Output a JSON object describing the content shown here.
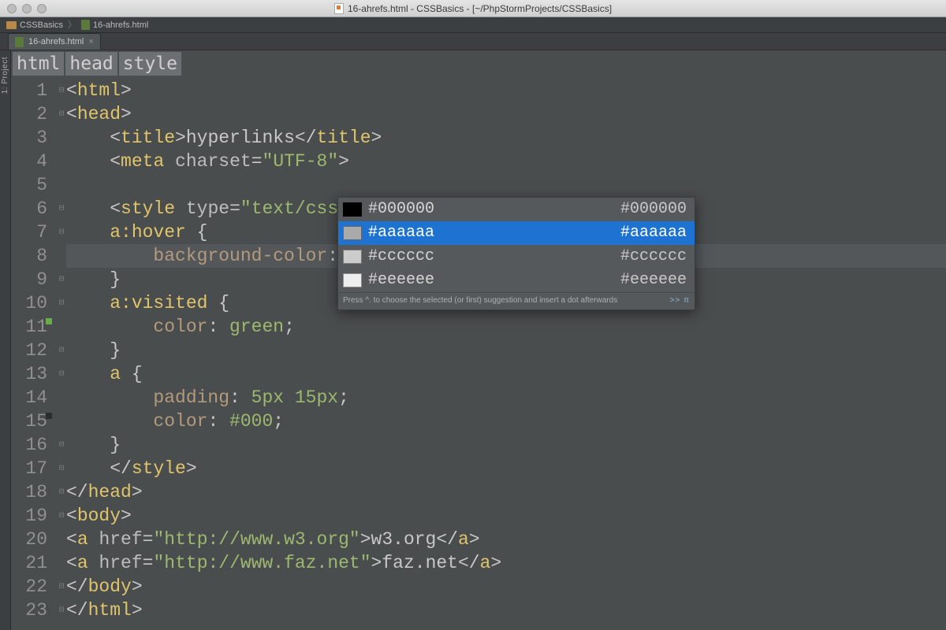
{
  "window": {
    "title": "16-ahrefs.html - CSSBasics - [~/PhpStormProjects/CSSBasics]"
  },
  "nav": {
    "project": "CSSBasics",
    "file": "16-ahrefs.html"
  },
  "tab": {
    "label": "16-ahrefs.html"
  },
  "sidestrip": {
    "label": "1: Project"
  },
  "tagcrumb": {
    "a": "html",
    "b": "head",
    "c": "style"
  },
  "code": {
    "l1": {
      "open": "<",
      "tag": "html",
      "close": ">"
    },
    "l2": {
      "open": "<",
      "tag": "head",
      "close": ">"
    },
    "l3": {
      "indent": "    ",
      "open": "<",
      "tag": "title",
      "close": ">",
      "text": "hyperlinks",
      "eopen": "</",
      "etag": "title",
      "eclose": ">"
    },
    "l4": {
      "indent": "    ",
      "open": "<",
      "tag": "meta",
      "sp": " ",
      "attr": "charset",
      "eq": "=",
      "q1": "\"",
      "val": "UTF-8",
      "q2": "\"",
      "close": ">"
    },
    "l6": {
      "indent": "    ",
      "open": "<",
      "tag": "style",
      "sp": " ",
      "attr": "type",
      "eq": "=",
      "q1": "\"",
      "val": "text/css",
      "q2": "\"",
      "close": ">"
    },
    "l7": {
      "indent": "    ",
      "sel": "a:hover",
      "sp": " ",
      "brace": "{"
    },
    "l8": {
      "indent": "        ",
      "prop": "background-color",
      "colon": ": ",
      "val": "#",
      "semi": ";"
    },
    "l9": {
      "indent": "    ",
      "brace": "}"
    },
    "l10": {
      "indent": "    ",
      "sel": "a:visited",
      "sp": " ",
      "brace": "{"
    },
    "l11": {
      "indent": "        ",
      "prop": "color",
      "colon": ": ",
      "val": "green",
      "semi": ";"
    },
    "l12": {
      "indent": "    ",
      "brace": "}"
    },
    "l13": {
      "indent": "    ",
      "sel": "a",
      "sp": " ",
      "brace": "{"
    },
    "l14": {
      "indent": "        ",
      "prop": "padding",
      "colon": ": ",
      "val": "5px 15px",
      "semi": ";"
    },
    "l15": {
      "indent": "        ",
      "prop": "color",
      "colon": ": ",
      "val": "#000",
      "semi": ";"
    },
    "l16": {
      "indent": "    ",
      "brace": "}"
    },
    "l17": {
      "indent": "    ",
      "open": "</",
      "tag": "style",
      "close": ">"
    },
    "l18": {
      "open": "</",
      "tag": "head",
      "close": ">"
    },
    "l19": {
      "open": "<",
      "tag": "body",
      "close": ">"
    },
    "l20": {
      "open": "<",
      "tag": "a",
      "sp": " ",
      "attr": "href",
      "eq": "=",
      "q1": "\"",
      "val": "http://www.w3.org",
      "q2": "\"",
      "close": ">",
      "text": "w3.org",
      "eopen": "</",
      "etag": "a",
      "eclose": ">"
    },
    "l21": {
      "open": "<",
      "tag": "a",
      "sp": " ",
      "attr": "href",
      "eq": "=",
      "q1": "\"",
      "val": "http://www.faz.net",
      "q2": "\"",
      "close": ">",
      "text": "faz.net",
      "eopen": "</",
      "etag": "a",
      "eclose": ">"
    },
    "l22": {
      "open": "</",
      "tag": "body",
      "close": ">"
    },
    "l23": {
      "open": "</",
      "tag": "html",
      "close": ">"
    }
  },
  "line_numbers": {
    "n1": "1",
    "n2": "2",
    "n3": "3",
    "n4": "4",
    "n5": "5",
    "n6": "6",
    "n7": "7",
    "n8": "8",
    "n9": "9",
    "n10": "10",
    "n11": "11",
    "n12": "12",
    "n13": "13",
    "n14": "14",
    "n15": "15",
    "n16": "16",
    "n17": "17",
    "n18": "18",
    "n19": "19",
    "n20": "20",
    "n21": "21",
    "n22": "22",
    "n23": "23"
  },
  "autocomplete": {
    "items": [
      {
        "label": "#000000",
        "tail": "#000000",
        "swatch": "#000000"
      },
      {
        "label": "#aaaaaa",
        "tail": "#aaaaaa",
        "swatch": "#aaaaaa"
      },
      {
        "label": "#cccccc",
        "tail": "#cccccc",
        "swatch": "#cccccc"
      },
      {
        "label": "#eeeeee",
        "tail": "#eeeeee",
        "swatch": "#eeeeee"
      }
    ],
    "selected_index": 1,
    "hint": "Press ^. to choose the selected (or first) suggestion and insert a dot afterwards",
    "hint_tail": ">> π"
  }
}
